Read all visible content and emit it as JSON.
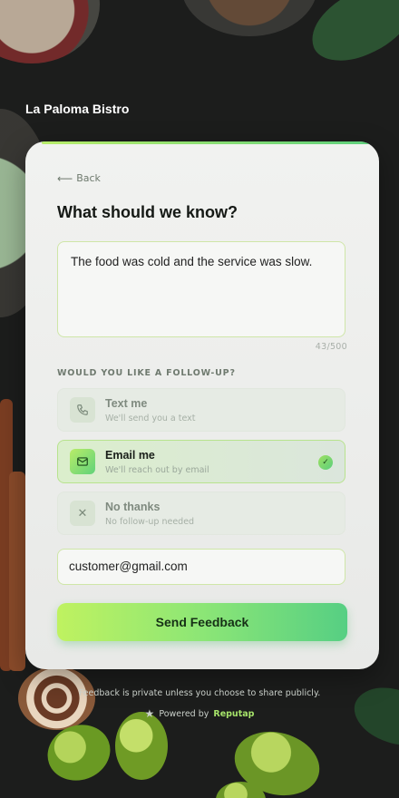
{
  "brand": {
    "name": "La Paloma Bistro"
  },
  "card": {
    "back_label": "Back",
    "title": "What should we know?",
    "feedback_text": "The food was cold and the service was slow.",
    "char_counter": "43/500",
    "followup_label": "WOULD YOU LIKE A FOLLOW-UP?",
    "options": [
      {
        "title": "Text me",
        "subtitle": "We'll send you a text",
        "icon": "phone-icon",
        "selected": false
      },
      {
        "title": "Email me",
        "subtitle": "We'll reach out by email",
        "icon": "mail-icon",
        "selected": true
      },
      {
        "title": "No thanks",
        "subtitle": "No follow-up needed",
        "icon": "close-icon",
        "selected": false
      }
    ],
    "email_value": "customer@gmail.com",
    "send_label": "Send Feedback"
  },
  "footer": {
    "privacy_text": "Feedback is private unless you choose to share publicly.",
    "powered_by": "Powered by",
    "powered_brand": "Reputap"
  },
  "colors": {
    "accent_start": "#bff260",
    "accent_end": "#56cf83",
    "background": "#1c1d1c"
  }
}
